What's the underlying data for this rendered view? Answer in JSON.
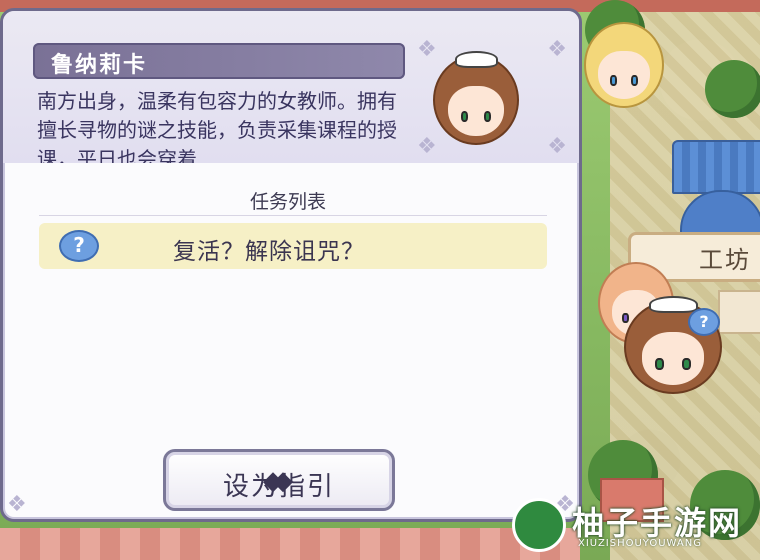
{
  "character": {
    "name": "鲁纳莉卡",
    "description": "南方出身，温柔有包容力的女教师。拥有擅长寻物的谜之技能，负责采集课程的授课，平日也会穿着"
  },
  "missions": {
    "title": "任务列表",
    "items": [
      {
        "icon": "?",
        "label": "复活？解除诅咒？"
      }
    ]
  },
  "actions": {
    "guide_button": "设为指引"
  },
  "map": {
    "workshop_sign": "工坊",
    "npc_quest_icon": "?"
  },
  "watermark": {
    "title": "柚子手游网",
    "subtitle": "XIUZISHOUYOUWANG"
  },
  "colors": {
    "name_bar": "#8078a0",
    "quest_highlight": "#f6f0c6",
    "panel_border": "#6e6a8c"
  }
}
